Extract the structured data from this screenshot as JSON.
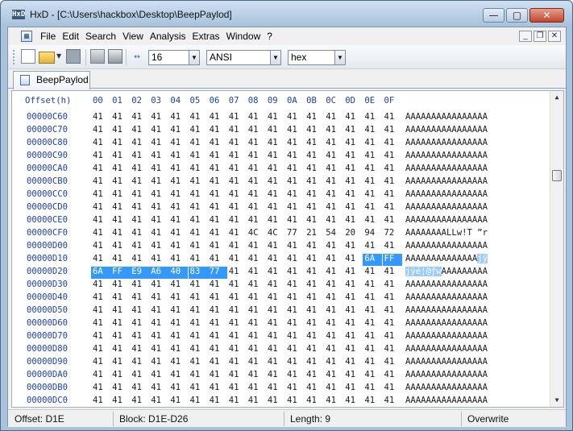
{
  "window": {
    "title": "HxD - [C:\\Users\\hackbox\\Desktop\\BeepPaylod]",
    "app_icon_text": "HxD",
    "minimize_glyph": "—",
    "maximize_glyph": "▢",
    "close_glyph": "✕"
  },
  "menu": {
    "items": [
      "File",
      "Edit",
      "Search",
      "View",
      "Analysis",
      "Extras",
      "Window",
      "?"
    ],
    "mdi_minimize": "_",
    "mdi_restore": "❐",
    "mdi_close": "✕"
  },
  "toolbar": {
    "bytes_per_row": "16",
    "charset": "ANSI",
    "offset_base": "hex",
    "icons": [
      "new-file-icon",
      "open-file-icon",
      "save-icon",
      "tools-icon",
      "cut-icon",
      "bytes-per-row-icon"
    ]
  },
  "tab": {
    "label": "BeepPaylod"
  },
  "hexview": {
    "offset_header": "Offset(h)",
    "column_headers": [
      "00",
      "01",
      "02",
      "03",
      "04",
      "05",
      "06",
      "07",
      "08",
      "09",
      "0A",
      "0B",
      "0C",
      "0D",
      "0E",
      "0F"
    ],
    "rows": [
      {
        "offset": "00000C60",
        "bytes": [
          "41",
          "41",
          "41",
          "41",
          "41",
          "41",
          "41",
          "41",
          "41",
          "41",
          "41",
          "41",
          "41",
          "41",
          "41",
          "41"
        ],
        "ascii": "AAAAAAAAAAAAAAAA"
      },
      {
        "offset": "00000C70",
        "bytes": [
          "41",
          "41",
          "41",
          "41",
          "41",
          "41",
          "41",
          "41",
          "41",
          "41",
          "41",
          "41",
          "41",
          "41",
          "41",
          "41"
        ],
        "ascii": "AAAAAAAAAAAAAAAA"
      },
      {
        "offset": "00000C80",
        "bytes": [
          "41",
          "41",
          "41",
          "41",
          "41",
          "41",
          "41",
          "41",
          "41",
          "41",
          "41",
          "41",
          "41",
          "41",
          "41",
          "41"
        ],
        "ascii": "AAAAAAAAAAAAAAAA"
      },
      {
        "offset": "00000C90",
        "bytes": [
          "41",
          "41",
          "41",
          "41",
          "41",
          "41",
          "41",
          "41",
          "41",
          "41",
          "41",
          "41",
          "41",
          "41",
          "41",
          "41"
        ],
        "ascii": "AAAAAAAAAAAAAAAA"
      },
      {
        "offset": "00000CA0",
        "bytes": [
          "41",
          "41",
          "41",
          "41",
          "41",
          "41",
          "41",
          "41",
          "41",
          "41",
          "41",
          "41",
          "41",
          "41",
          "41",
          "41"
        ],
        "ascii": "AAAAAAAAAAAAAAAA"
      },
      {
        "offset": "00000CB0",
        "bytes": [
          "41",
          "41",
          "41",
          "41",
          "41",
          "41",
          "41",
          "41",
          "41",
          "41",
          "41",
          "41",
          "41",
          "41",
          "41",
          "41"
        ],
        "ascii": "AAAAAAAAAAAAAAAA"
      },
      {
        "offset": "00000CC0",
        "bytes": [
          "41",
          "41",
          "41",
          "41",
          "41",
          "41",
          "41",
          "41",
          "41",
          "41",
          "41",
          "41",
          "41",
          "41",
          "41",
          "41"
        ],
        "ascii": "AAAAAAAAAAAAAAAA"
      },
      {
        "offset": "00000CD0",
        "bytes": [
          "41",
          "41",
          "41",
          "41",
          "41",
          "41",
          "41",
          "41",
          "41",
          "41",
          "41",
          "41",
          "41",
          "41",
          "41",
          "41"
        ],
        "ascii": "AAAAAAAAAAAAAAAA"
      },
      {
        "offset": "00000CE0",
        "bytes": [
          "41",
          "41",
          "41",
          "41",
          "41",
          "41",
          "41",
          "41",
          "41",
          "41",
          "41",
          "41",
          "41",
          "41",
          "41",
          "41"
        ],
        "ascii": "AAAAAAAAAAAAAAAA"
      },
      {
        "offset": "00000CF0",
        "bytes": [
          "41",
          "41",
          "41",
          "41",
          "41",
          "41",
          "41",
          "41",
          "4C",
          "4C",
          "77",
          "21",
          "54",
          "20",
          "94",
          "72"
        ],
        "ascii": "AAAAAAAALLw!T ”r"
      },
      {
        "offset": "00000D00",
        "bytes": [
          "41",
          "41",
          "41",
          "41",
          "41",
          "41",
          "41",
          "41",
          "41",
          "41",
          "41",
          "41",
          "41",
          "41",
          "41",
          "41"
        ],
        "ascii": "AAAAAAAAAAAAAAAA"
      },
      {
        "offset": "00000D10",
        "bytes": [
          "41",
          "41",
          "41",
          "41",
          "41",
          "41",
          "41",
          "41",
          "41",
          "41",
          "41",
          "41",
          "41",
          "41",
          "6A",
          "FF"
        ],
        "ascii": "AAAAAAAAAAAAAAjÿ"
      },
      {
        "offset": "00000D20",
        "bytes": [
          "6A",
          "FF",
          "E9",
          "A6",
          "40",
          "83",
          "77",
          "41",
          "41",
          "41",
          "41",
          "41",
          "41",
          "41",
          "41",
          "41"
        ],
        "ascii": "jÿé¦@ƒwAAAAAAAAA"
      },
      {
        "offset": "00000D30",
        "bytes": [
          "41",
          "41",
          "41",
          "41",
          "41",
          "41",
          "41",
          "41",
          "41",
          "41",
          "41",
          "41",
          "41",
          "41",
          "41",
          "41"
        ],
        "ascii": "AAAAAAAAAAAAAAAA"
      },
      {
        "offset": "00000D40",
        "bytes": [
          "41",
          "41",
          "41",
          "41",
          "41",
          "41",
          "41",
          "41",
          "41",
          "41",
          "41",
          "41",
          "41",
          "41",
          "41",
          "41"
        ],
        "ascii": "AAAAAAAAAAAAAAAA"
      },
      {
        "offset": "00000D50",
        "bytes": [
          "41",
          "41",
          "41",
          "41",
          "41",
          "41",
          "41",
          "41",
          "41",
          "41",
          "41",
          "41",
          "41",
          "41",
          "41",
          "41"
        ],
        "ascii": "AAAAAAAAAAAAAAAA"
      },
      {
        "offset": "00000D60",
        "bytes": [
          "41",
          "41",
          "41",
          "41",
          "41",
          "41",
          "41",
          "41",
          "41",
          "41",
          "41",
          "41",
          "41",
          "41",
          "41",
          "41"
        ],
        "ascii": "AAAAAAAAAAAAAAAA"
      },
      {
        "offset": "00000D70",
        "bytes": [
          "41",
          "41",
          "41",
          "41",
          "41",
          "41",
          "41",
          "41",
          "41",
          "41",
          "41",
          "41",
          "41",
          "41",
          "41",
          "41"
        ],
        "ascii": "AAAAAAAAAAAAAAAA"
      },
      {
        "offset": "00000D80",
        "bytes": [
          "41",
          "41",
          "41",
          "41",
          "41",
          "41",
          "41",
          "41",
          "41",
          "41",
          "41",
          "41",
          "41",
          "41",
          "41",
          "41"
        ],
        "ascii": "AAAAAAAAAAAAAAAA"
      },
      {
        "offset": "00000D90",
        "bytes": [
          "41",
          "41",
          "41",
          "41",
          "41",
          "41",
          "41",
          "41",
          "41",
          "41",
          "41",
          "41",
          "41",
          "41",
          "41",
          "41"
        ],
        "ascii": "AAAAAAAAAAAAAAAA"
      },
      {
        "offset": "00000DA0",
        "bytes": [
          "41",
          "41",
          "41",
          "41",
          "41",
          "41",
          "41",
          "41",
          "41",
          "41",
          "41",
          "41",
          "41",
          "41",
          "41",
          "41"
        ],
        "ascii": "AAAAAAAAAAAAAAAA"
      },
      {
        "offset": "00000DB0",
        "bytes": [
          "41",
          "41",
          "41",
          "41",
          "41",
          "41",
          "41",
          "41",
          "41",
          "41",
          "41",
          "41",
          "41",
          "41",
          "41",
          "41"
        ],
        "ascii": "AAAAAAAAAAAAAAAA"
      },
      {
        "offset": "00000DC0",
        "bytes": [
          "41",
          "41",
          "41",
          "41",
          "41",
          "41",
          "41",
          "41",
          "41",
          "41",
          "41",
          "41",
          "41",
          "41",
          "41",
          "41"
        ],
        "ascii": "AAAAAAAAAAAAAAAA"
      }
    ],
    "selection": {
      "start": "D1E",
      "end": "D26"
    },
    "colors": {
      "offset": "#1f3fb0",
      "selection": "#3399ff",
      "ascii_selection": "#9ccbff"
    }
  },
  "status": {
    "offset": "Offset: D1E",
    "block": "Block: D1E-D26",
    "length": "Length: 9",
    "mode": "Overwrite"
  }
}
